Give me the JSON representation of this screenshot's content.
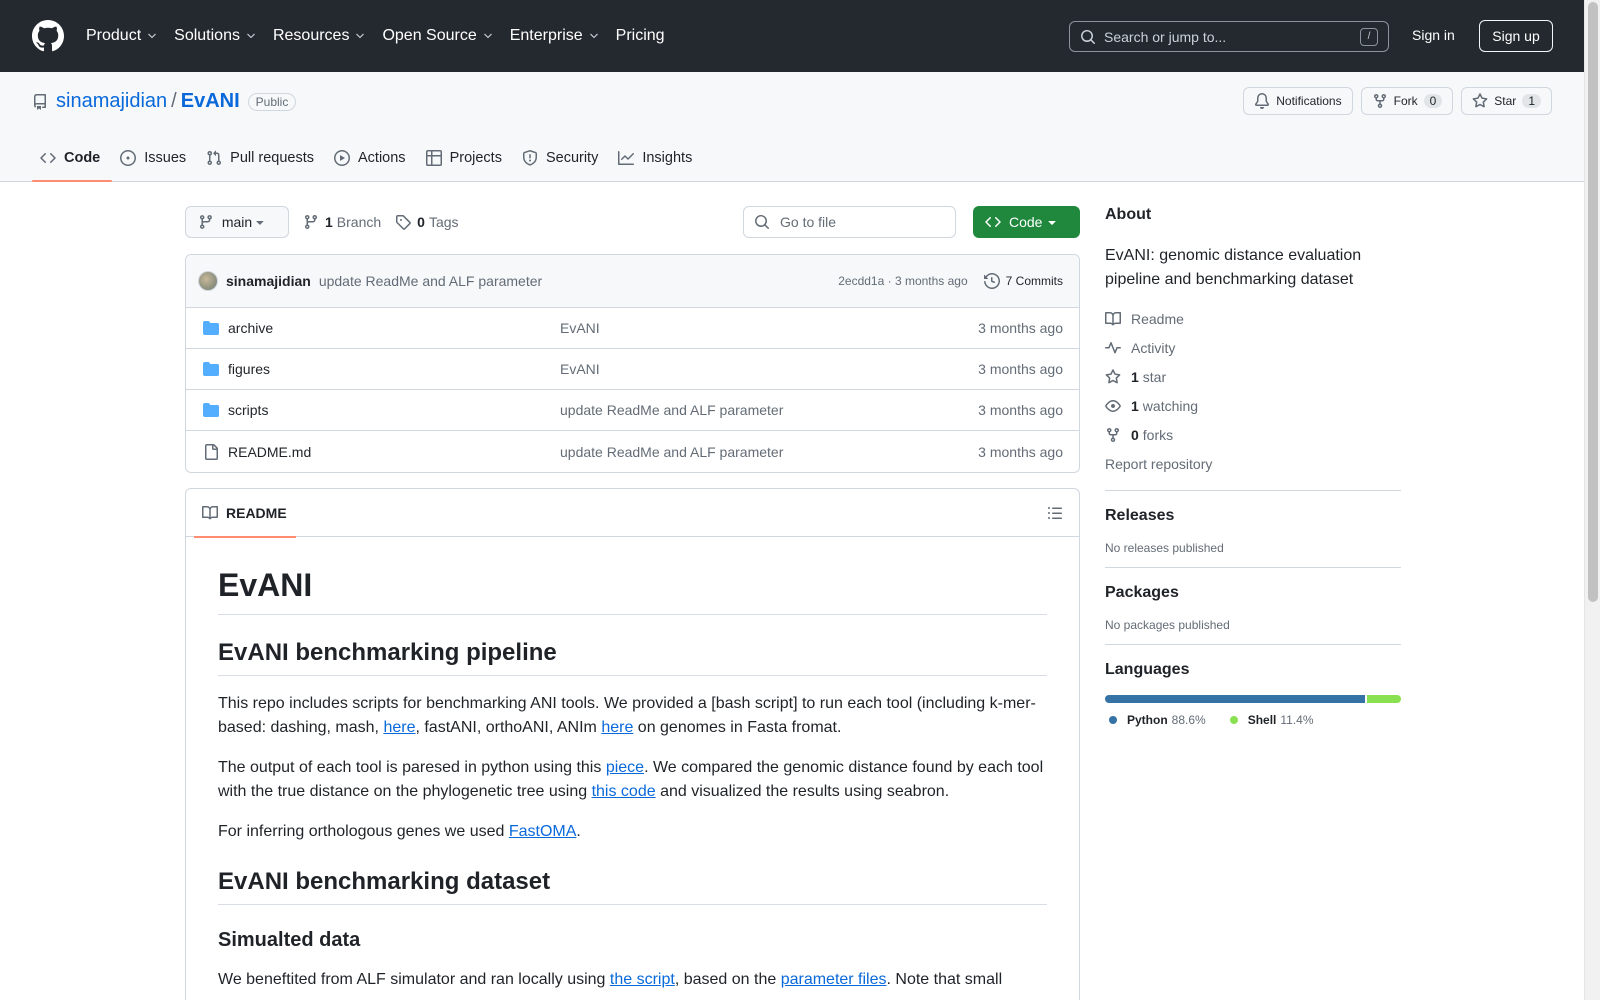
{
  "header": {
    "nav": [
      "Product",
      "Solutions",
      "Resources",
      "Open Source",
      "Enterprise",
      "Pricing"
    ],
    "search_placeholder": "Search or jump to...",
    "search_shortcut": "/",
    "sign_in": "Sign in",
    "sign_up": "Sign up"
  },
  "repo": {
    "owner": "sinamajidian",
    "separator": "/",
    "name": "EvANI",
    "visibility": "Public",
    "notifications_label": "Notifications",
    "fork_label": "Fork",
    "fork_count": "0",
    "star_label": "Star",
    "star_count": "1"
  },
  "tabs": [
    "Code",
    "Issues",
    "Pull requests",
    "Actions",
    "Projects",
    "Security",
    "Insights"
  ],
  "file_nav": {
    "branch": "main",
    "branch_count": "1",
    "branch_label": "Branch",
    "tag_count": "0",
    "tag_label": "Tags",
    "go_to_file": "Go to file",
    "code_button": "Code"
  },
  "latest_commit": {
    "author": "sinamajidian",
    "message": "update ReadMe and ALF parameter",
    "meta": "2ecdd1a · 3 months ago",
    "commits": "7 Commits"
  },
  "files": [
    {
      "name": "archive",
      "type": "dir",
      "message": "EvANI",
      "age": "3 months ago"
    },
    {
      "name": "figures",
      "type": "dir",
      "message": "EvANI",
      "age": "3 months ago"
    },
    {
      "name": "scripts",
      "type": "dir",
      "message": "update ReadMe and ALF parameter",
      "age": "3 months ago"
    },
    {
      "name": "README.md",
      "type": "file",
      "message": "update ReadMe and ALF parameter",
      "age": "3 months ago"
    }
  ],
  "readme": {
    "tab_label": "README",
    "h1": "EvANI",
    "h2_pipeline": "EvANI benchmarking pipeline",
    "p1": {
      "a": "This repo includes scripts for benchmarking ANI tools. We provided a [bash script] to run each tool (including k-mer-based: dashing, mash, ",
      "link1": "here",
      "b": ", fastANI, orthoANI, ANIm ",
      "link2": "here",
      "c": " on genomes in Fasta fromat."
    },
    "p2": {
      "a": "The output of each tool is paresed in python using this ",
      "link1": "piece",
      "b": ". We compared the genomic distance found by each tool with the true distance on the phylogenetic tree using ",
      "link2": "this code",
      "c": " and visualized the results using seabron."
    },
    "p3": {
      "a": "For inferring orthologous genes we used ",
      "link1": "FastOMA",
      "b": "."
    },
    "h2_dataset": "EvANI benchmarking dataset",
    "h3_sim": "Simualted data",
    "p4": {
      "a": "We beneftited from ALF simulator and ran locally using ",
      "link1": "the script",
      "b": ", based on the ",
      "link2": "parameter files",
      "c": ". Note that small"
    }
  },
  "about": {
    "title": "About",
    "description": "EvANI: genomic distance evaluation pipeline and benchmarking dataset",
    "readme": "Readme",
    "activity": "Activity",
    "stars_count": "1",
    "stars_label": "star",
    "watching_count": "1",
    "watching_label": "watching",
    "forks_count": "0",
    "forks_label": "forks",
    "report": "Report repository"
  },
  "releases": {
    "title": "Releases",
    "empty": "No releases published"
  },
  "packages": {
    "title": "Packages",
    "empty": "No packages published"
  },
  "languages": {
    "title": "Languages",
    "items": [
      {
        "name": "Python",
        "percent": "88.6%",
        "value": 88.6,
        "color": "#3572A5"
      },
      {
        "name": "Shell",
        "percent": "11.4%",
        "value": 11.4,
        "color": "#89e051"
      }
    ]
  }
}
